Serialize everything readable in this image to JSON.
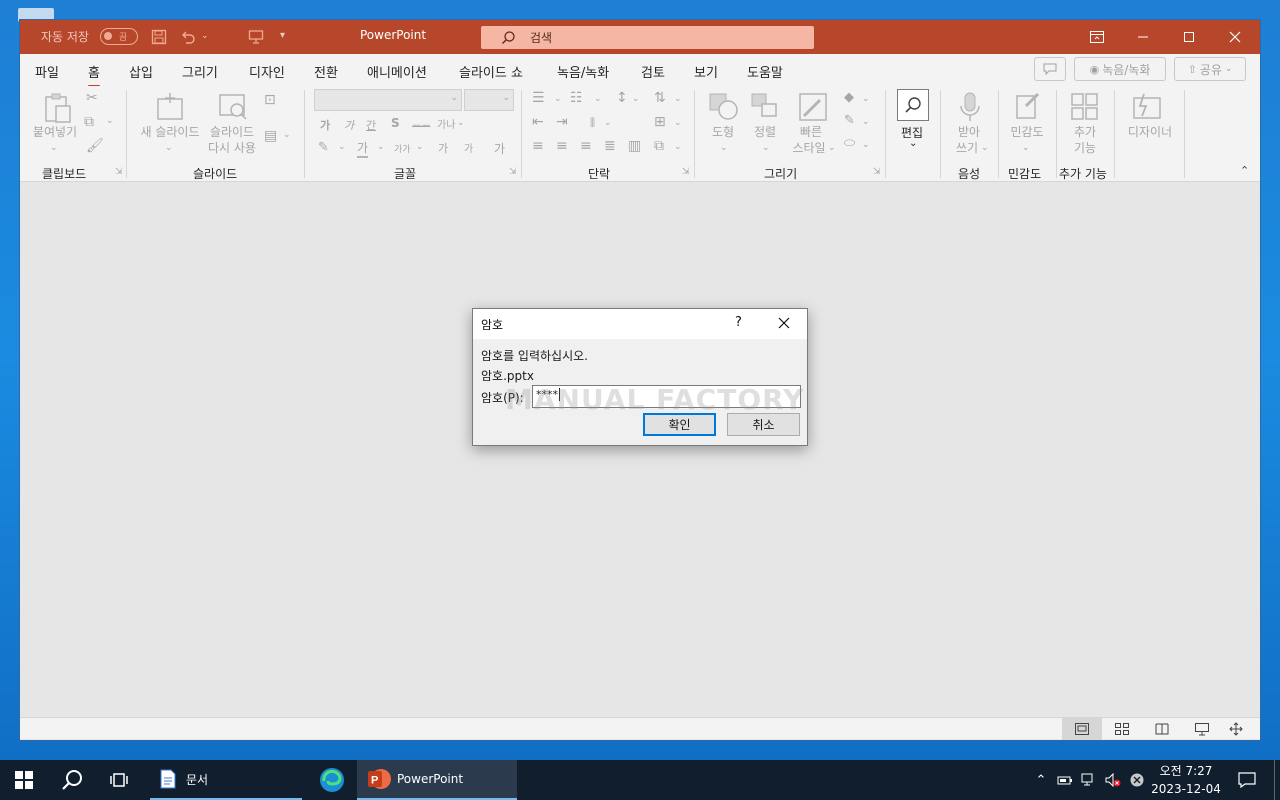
{
  "titlebar": {
    "autosave_label": "자동 저장",
    "autosave_state": "끔",
    "app_title": "PowerPoint",
    "search_placeholder": "검색"
  },
  "menu": {
    "tabs": [
      "파일",
      "홈",
      "삽입",
      "그리기",
      "디자인",
      "전환",
      "애니메이션",
      "슬라이드 쇼",
      "녹음/녹화",
      "검토",
      "보기",
      "도움말"
    ],
    "record_button": "녹음/녹화",
    "share_button": "공유"
  },
  "ribbon": {
    "clipboard": {
      "paste": "붙여넣기",
      "group": "클립보드"
    },
    "slides": {
      "new_slide": "새 슬라이드",
      "reuse_line1": "슬라이드",
      "reuse_line2": "다시 사용",
      "group": "슬라이드"
    },
    "font": {
      "group": "글꼴",
      "bold": "가",
      "italic": "가",
      "underline": "간",
      "strike": "S",
      "spacing": "가나",
      "font_color": "가",
      "case": "가가",
      "grow": "가",
      "shrink": "가",
      "clear": "가"
    },
    "paragraph": {
      "group": "단락"
    },
    "drawing": {
      "shapes": "도형",
      "arrange": "정렬",
      "quick1": "빠른",
      "quick2": "스타일",
      "group": "그리기"
    },
    "editing": {
      "edit": "편집"
    },
    "voice": {
      "dictate1": "받아",
      "dictate2": "쓰기",
      "group": "음성"
    },
    "sensitivity": {
      "label": "민감도",
      "group": "민감도"
    },
    "addins": {
      "line1": "추가",
      "line2": "기능",
      "group": "추가 기능"
    },
    "designer": {
      "label": "디자이너"
    }
  },
  "dialog": {
    "title": "암호",
    "help": "?",
    "prompt": "암호를 입력하십시오.",
    "filename": "암호.pptx",
    "password_label": "암호(P):",
    "password_value": "****",
    "ok": "확인",
    "cancel": "취소",
    "watermark": "MANUAL FACTORY"
  },
  "taskbar": {
    "explorer_label": "문서",
    "powerpoint_label": "PowerPoint",
    "time": "오전 7:27",
    "date": "2023-12-04"
  },
  "colors": {
    "accent": "#b7472a",
    "taskbar": "#101e2e",
    "desktop": "#1a8be0"
  }
}
